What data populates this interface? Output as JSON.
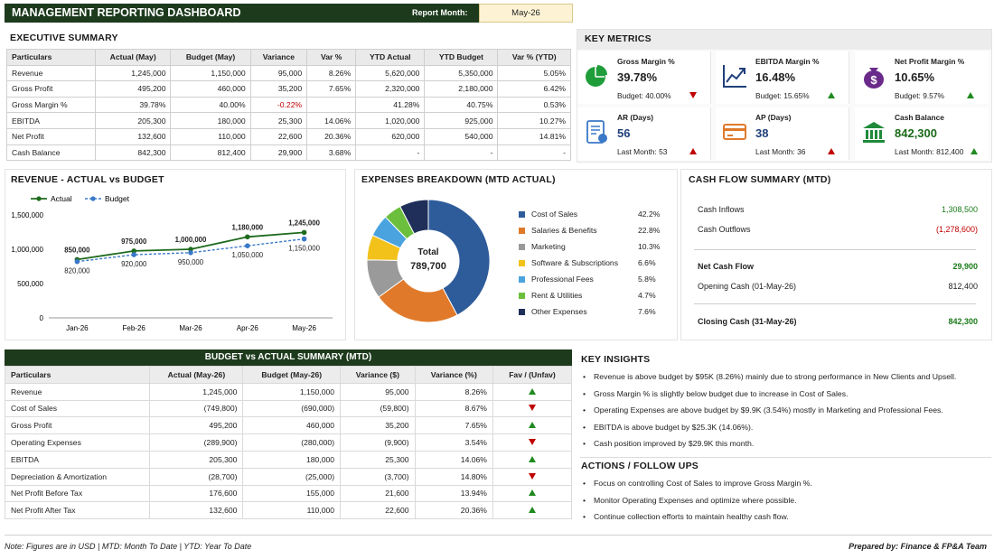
{
  "header": {
    "title": "MANAGEMENT REPORTING DASHBOARD",
    "report_month_label": "Report Month:",
    "report_month_value": "May-26"
  },
  "exec_summary": {
    "title": "EXECUTIVE SUMMARY",
    "columns": [
      "Particulars",
      "Actual (May)",
      "Budget (May)",
      "Variance",
      "Var %",
      "YTD Actual",
      "YTD Budget",
      "Var % (YTD)"
    ],
    "rows": [
      [
        "Revenue",
        "1,245,000",
        "1,150,000",
        "95,000",
        "8.26%",
        "5,620,000",
        "5,350,000",
        "5.05%"
      ],
      [
        "Gross Profit",
        "495,200",
        "460,000",
        "35,200",
        "7.65%",
        "2,320,000",
        "2,180,000",
        "6.42%"
      ],
      [
        "Gross Margin %",
        "39.78%",
        "40.00%",
        "-0.22%",
        "",
        "41.28%",
        "40.75%",
        "0.53%"
      ],
      [
        "EBITDA",
        "205,300",
        "180,000",
        "25,300",
        "14.06%",
        "1,020,000",
        "925,000",
        "10.27%"
      ],
      [
        "Net Profit",
        "132,600",
        "110,000",
        "22,600",
        "20.36%",
        "620,000",
        "540,000",
        "14.81%"
      ],
      [
        "Cash Balance",
        "842,300",
        "812,400",
        "29,900",
        "3.68%",
        "-",
        "-",
        "-"
      ]
    ]
  },
  "key_metrics": {
    "title": "KEY METRICS",
    "items": [
      {
        "label": "Gross Margin %",
        "value": "39.78%",
        "sub": "Budget: 40.00%",
        "trend": "down",
        "icon": "pie-chart-icon",
        "color": "#1f9d3a"
      },
      {
        "label": "EBITDA Margin %",
        "value": "16.48%",
        "sub": "Budget: 15.65%",
        "trend": "up",
        "icon": "line-trend-icon",
        "color": "#1f3f7a"
      },
      {
        "label": "Net Profit Margin %",
        "value": "10.65%",
        "sub": "Budget: 9.57%",
        "trend": "up",
        "icon": "money-bag-icon",
        "color": "#6a2a8a"
      },
      {
        "label": "AR (Days)",
        "value": "56",
        "sub": "Last Month: 53",
        "trend": "up",
        "icon": "invoice-icon",
        "color": "#3a78c8"
      },
      {
        "label": "AP (Days)",
        "value": "38",
        "sub": "Last Month: 36",
        "trend": "up",
        "icon": "credit-card-icon",
        "color": "#e07a2a"
      },
      {
        "label": "Cash Balance",
        "value": "842,300",
        "sub": "Last Month: 812,400",
        "trend": "up",
        "icon": "bank-icon",
        "color": "#1f8a3a"
      }
    ]
  },
  "revenue_chart": {
    "title": "REVENUE - ACTUAL vs BUDGET",
    "legend_actual": "Actual",
    "legend_budget": "Budget"
  },
  "chart_data": [
    {
      "type": "line",
      "title": "REVENUE - ACTUAL vs BUDGET",
      "categories": [
        "Jan-26",
        "Feb-26",
        "Mar-26",
        "Apr-26",
        "May-26"
      ],
      "y_ticks": [
        "1,500,000",
        "1,000,000",
        "500,000",
        "0"
      ],
      "ylim": [
        0,
        1500000
      ],
      "series": [
        {
          "name": "Actual",
          "color": "#1e6b1e",
          "values": [
            850000,
            975000,
            1000000,
            1180000,
            1245000
          ],
          "labels": [
            "850,000",
            "975,000",
            "1,000,000",
            "1,180,000",
            "1,245,000"
          ]
        },
        {
          "name": "Budget",
          "color": "#3a78c8",
          "values": [
            820000,
            920000,
            950000,
            1050000,
            1150000
          ],
          "labels": [
            "820,000",
            "920,000",
            "950,000",
            "1,050,000",
            "1,150,000"
          ]
        }
      ]
    },
    {
      "type": "pie",
      "title": "EXPENSES BREAKDOWN (MTD ACTUAL)",
      "center_label": "Total",
      "center_value": "789,700",
      "slices": [
        {
          "name": "Cost of Sales",
          "pct_label": "42.2%",
          "value": 42.2,
          "color": "#2e5b9a"
        },
        {
          "name": "Salaries & Benefits",
          "pct_label": "22.8%",
          "value": 22.8,
          "color": "#e07a2a"
        },
        {
          "name": "Marketing",
          "pct_label": "10.3%",
          "value": 10.3,
          "color": "#9a9a9a"
        },
        {
          "name": "Software & Subscriptions",
          "pct_label": "6.6%",
          "value": 6.6,
          "color": "#f2c21b"
        },
        {
          "name": "Professional Fees",
          "pct_label": "5.8%",
          "value": 5.8,
          "color": "#4aa3df"
        },
        {
          "name": "Rent & Utilities",
          "pct_label": "4.7%",
          "value": 4.7,
          "color": "#6cbf3c"
        },
        {
          "name": "Other Expenses",
          "pct_label": "7.6%",
          "value": 7.6,
          "color": "#1f2f5a"
        }
      ]
    }
  ],
  "cash_flow": {
    "title": "CASH FLOW SUMMARY (MTD)",
    "inflows_label": "Cash Inflows",
    "inflows_value": "1,308,500",
    "outflows_label": "Cash Outflows",
    "outflows_value": "(1,278,600)",
    "net_label": "Net Cash Flow",
    "net_value": "29,900",
    "opening_label": "Opening Cash (01-May-26)",
    "opening_value": "812,400",
    "closing_label": "Closing Cash (31-May-26)",
    "closing_value": "842,300"
  },
  "bva": {
    "title": "BUDGET vs ACTUAL SUMMARY (MTD)",
    "columns": [
      "Particulars",
      "Actual (May-26)",
      "Budget (May-26)",
      "Variance ($)",
      "Variance (%)",
      "Fav / (Unfav)"
    ],
    "rows": [
      {
        "cells": [
          "Revenue",
          "1,245,000",
          "1,150,000",
          "95,000",
          "8.26%"
        ],
        "fav": "up"
      },
      {
        "cells": [
          "Cost of Sales",
          "(749,800)",
          "(690,000)",
          "(59,800)",
          "8.67%"
        ],
        "fav": "down"
      },
      {
        "cells": [
          "Gross Profit",
          "495,200",
          "460,000",
          "35,200",
          "7.65%"
        ],
        "fav": "up"
      },
      {
        "cells": [
          "Operating Expenses",
          "(289,900)",
          "(280,000)",
          "(9,900)",
          "3.54%"
        ],
        "fav": "down"
      },
      {
        "cells": [
          "EBITDA",
          "205,300",
          "180,000",
          "25,300",
          "14.06%"
        ],
        "fav": "up"
      },
      {
        "cells": [
          "Depreciation & Amortization",
          "(28,700)",
          "(25,000)",
          "(3,700)",
          "14.80%"
        ],
        "fav": "down"
      },
      {
        "cells": [
          "Net Profit Before Tax",
          "176,600",
          "155,000",
          "21,600",
          "13.94%"
        ],
        "fav": "up"
      },
      {
        "cells": [
          "Net Profit After Tax",
          "132,600",
          "110,000",
          "22,600",
          "20.36%"
        ],
        "fav": "up"
      }
    ]
  },
  "insights": {
    "title": "KEY INSIGHTS",
    "items": [
      "Revenue is above budget by $95K (8.26%) mainly due to strong performance in New Clients and Upsell.",
      "Gross Margin % is slightly below budget due to increase in Cost of Sales.",
      "Operating Expenses are above budget by $9.9K (3.54%) mostly in Marketing and Professional Fees.",
      "EBITDA is above budget by $25.3K (14.06%).",
      "Cash position improved by $29.9K this month."
    ]
  },
  "actions": {
    "title": "ACTIONS / FOLLOW UPS",
    "items": [
      "Focus on controlling Cost of Sales to improve Gross Margin %.",
      "Monitor Operating Expenses and optimize where possible.",
      "Continue collection efforts to maintain healthy cash flow."
    ]
  },
  "footer": {
    "note": "Note: Figures are in USD | MTD: Month To Date | YTD: Year To Date",
    "prepared": "Prepared by: Finance & FP&A Team"
  }
}
